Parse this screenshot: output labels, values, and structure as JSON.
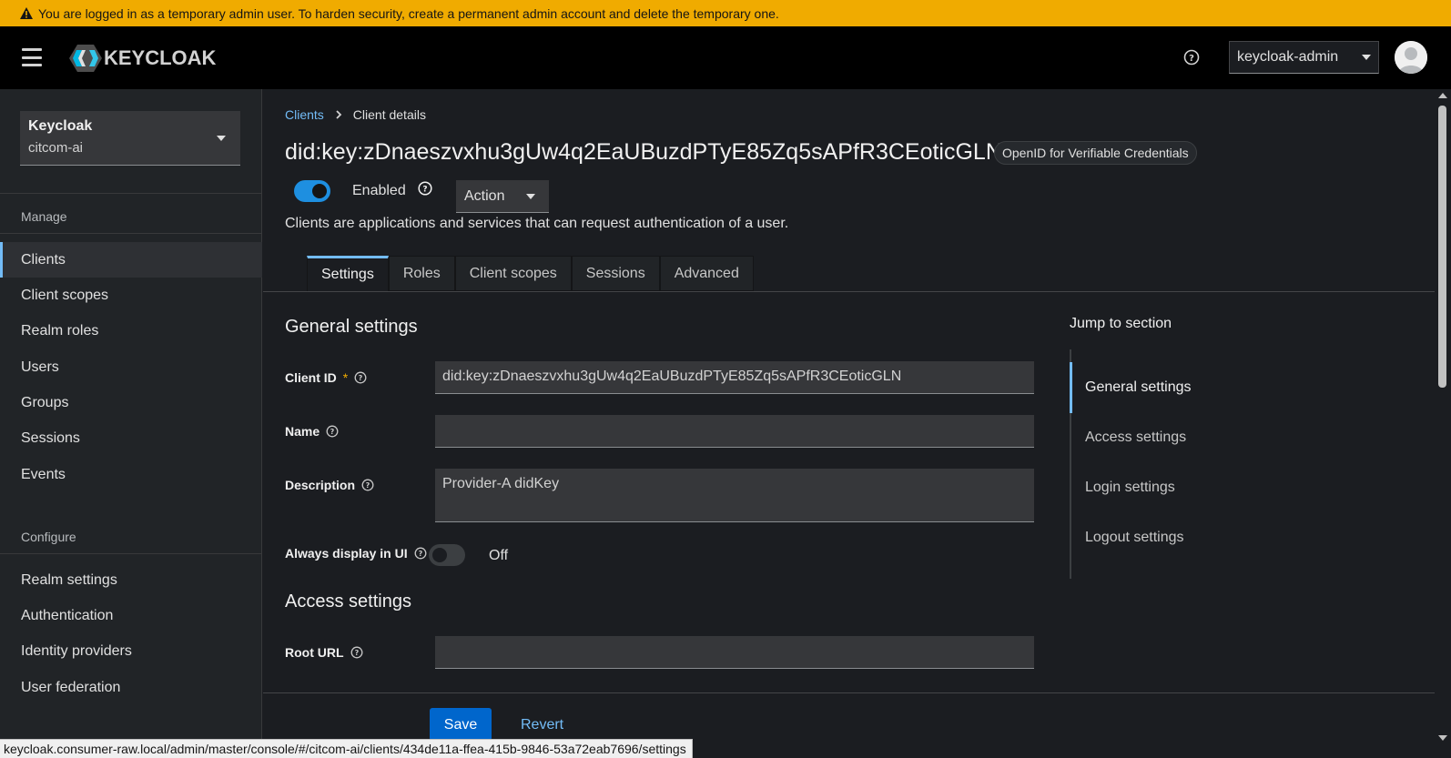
{
  "banner": {
    "text": "You are logged in as a temporary admin user. To harden security, create a permanent admin account and delete the temporary one."
  },
  "header": {
    "logo_text": "KEYCLOAK",
    "user_name": "keycloak-admin"
  },
  "sidebar": {
    "realm": {
      "title": "Keycloak",
      "name": "citcom-ai"
    },
    "manage_heading": "Manage",
    "manage_items": [
      {
        "label": "Clients",
        "active": true
      },
      {
        "label": "Client scopes"
      },
      {
        "label": "Realm roles"
      },
      {
        "label": "Users"
      },
      {
        "label": "Groups"
      },
      {
        "label": "Sessions"
      },
      {
        "label": "Events"
      }
    ],
    "configure_heading": "Configure",
    "configure_items": [
      {
        "label": "Realm settings"
      },
      {
        "label": "Authentication"
      },
      {
        "label": "Identity providers"
      },
      {
        "label": "User federation"
      }
    ]
  },
  "breadcrumb": {
    "parent": "Clients",
    "current": "Client details"
  },
  "client": {
    "title": "did:key:zDnaeszvxhu3gUw4q2EaUBuzdPTyE85Zq5sAPfR3CEoticGLN",
    "protocol_badge": "OpenID for Verifiable Credentials",
    "enabled_label": "Enabled",
    "action_label": "Action",
    "description_text": "Clients are applications and services that can request authentication of a user."
  },
  "tabs": [
    "Settings",
    "Roles",
    "Client scopes",
    "Sessions",
    "Advanced"
  ],
  "general_settings": {
    "title": "General settings",
    "client_id_label": "Client ID",
    "client_id_required": "*",
    "client_id_value": "did:key:zDnaeszvxhu3gUw4q2EaUBuzdPTyE85Zq5sAPfR3CEoticGLN",
    "name_label": "Name",
    "name_value": "",
    "description_label": "Description",
    "description_value": "Provider-A didKey",
    "always_display_label": "Always display in UI",
    "always_display_state": "Off"
  },
  "access_settings": {
    "title": "Access settings",
    "root_url_label": "Root URL",
    "root_url_value": ""
  },
  "jump": {
    "title": "Jump to section",
    "items": [
      "General settings",
      "Access settings",
      "Login settings",
      "Logout settings"
    ]
  },
  "buttons": {
    "save": "Save",
    "revert": "Revert"
  },
  "statusbar": {
    "url": "keycloak.consumer-raw.local/admin/master/console/#/citcom-ai/clients/434de11a-ffea-415b-9846-53a72eab7696/settings"
  },
  "colors": {
    "banner": "#f0ab00",
    "accent": "#73bcf7",
    "primary_button": "#0066cc",
    "toggle_on": "#1e8fe0"
  }
}
